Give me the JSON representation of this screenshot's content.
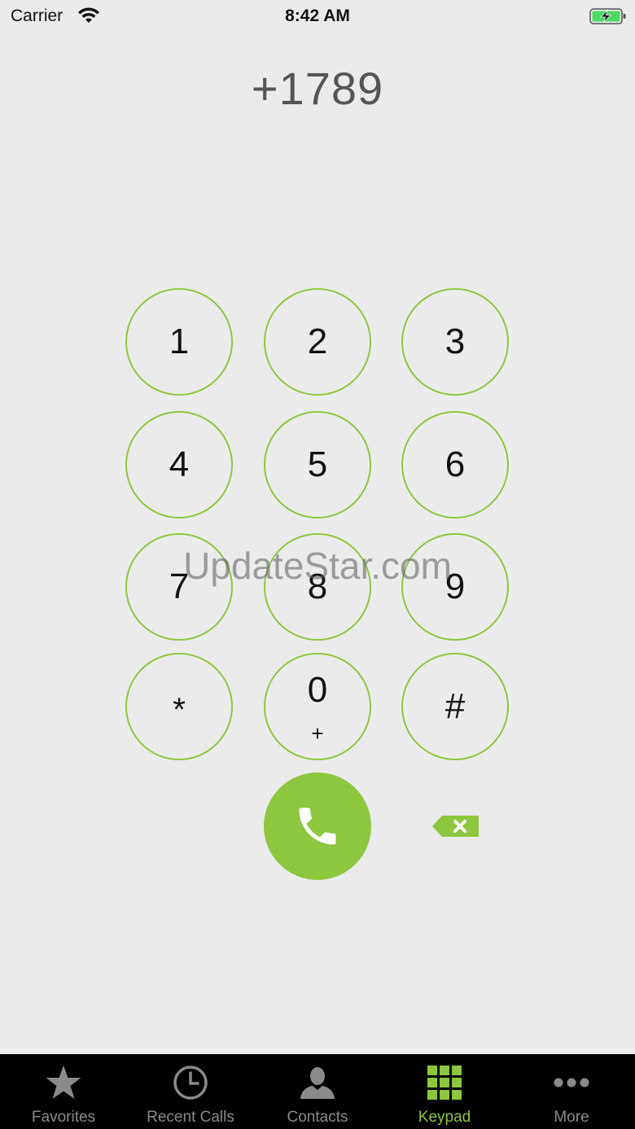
{
  "status_bar": {
    "carrier": "Carrier",
    "time": "8:42 AM"
  },
  "dialer": {
    "number": "+1789"
  },
  "keypad": {
    "keys": [
      {
        "digit": "1"
      },
      {
        "digit": "2"
      },
      {
        "digit": "3"
      },
      {
        "digit": "4"
      },
      {
        "digit": "5"
      },
      {
        "digit": "6"
      },
      {
        "digit": "7"
      },
      {
        "digit": "8"
      },
      {
        "digit": "9"
      },
      {
        "digit": "*"
      },
      {
        "digit": "0",
        "sub": "+"
      },
      {
        "digit": "#"
      }
    ]
  },
  "watermark": "UpdateStar.com",
  "tabs": [
    {
      "label": "Favorites",
      "icon": "star-icon"
    },
    {
      "label": "Recent Calls",
      "icon": "clock-icon"
    },
    {
      "label": "Contacts",
      "icon": "person-icon"
    },
    {
      "label": "Keypad",
      "icon": "keypad-icon",
      "active": true
    },
    {
      "label": "More",
      "icon": "more-icon"
    }
  ],
  "colors": {
    "accent": "#8dc63f",
    "tab_bar": "#000000",
    "background": "#ebebeb"
  }
}
